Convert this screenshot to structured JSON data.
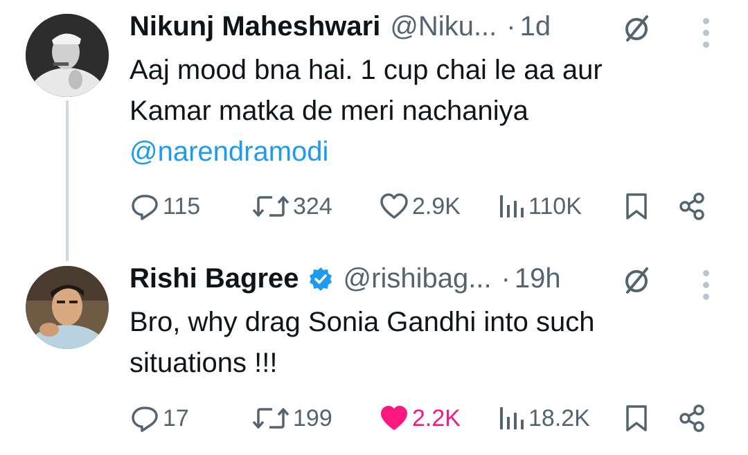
{
  "colors": {
    "link": "#1d9bf0",
    "muted": "#536471",
    "like": "#f91880",
    "verified": "#1d9bf0"
  },
  "tweets": [
    {
      "name": "Nikunj Maheshwari",
      "handle": "@Niku...",
      "dot": "·",
      "time": "1d",
      "verified": false,
      "text_lines": [
        "Aaj mood bna hai. 1 cup chai le aa aur",
        "Kamar matka de meri nachaniya"
      ],
      "mention": "@narendramodi",
      "replies": "115",
      "retweets": "324",
      "likes": "2.9K",
      "views": "110K",
      "liked": false,
      "icons": {
        "avatar": "avatar-photo",
        "reply": "reply-icon",
        "retweet": "retweet-icon",
        "like": "heart-icon",
        "views": "views-icon",
        "bookmark": "bookmark-icon",
        "share": "share-icon",
        "grok": "grok-icon",
        "more": "more-icon"
      }
    },
    {
      "name": "Rishi Bagree",
      "handle": "@rishibag...",
      "dot": "·",
      "time": "19h",
      "verified": true,
      "text_lines": [
        "Bro, why drag Sonia Gandhi into such",
        "situations !!!"
      ],
      "replies": "17",
      "retweets": "199",
      "likes": "2.2K",
      "views": "18.2K",
      "liked": true
    }
  ]
}
